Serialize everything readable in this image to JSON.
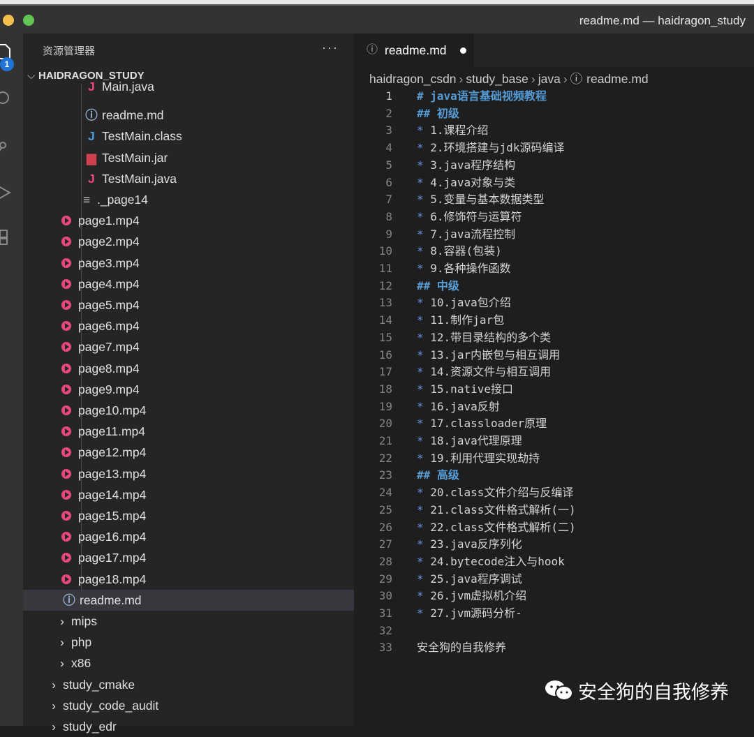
{
  "window": {
    "title": "readme.md — haidragon_study"
  },
  "activity": {
    "badge": "1"
  },
  "sidebar": {
    "header": "资源管理器",
    "more": "···",
    "root": "HAIDRAGON_STUDY",
    "items": [
      {
        "label": "Main.java",
        "icon": "java-icon",
        "glyph": "J",
        "color": "#e9487c"
      },
      {
        "label": "readme.md",
        "icon": "info-icon",
        "glyph": "ⓘ",
        "color": "#9ab6d6"
      },
      {
        "label": "TestMain.class",
        "icon": "java-class-icon",
        "glyph": "J",
        "color": "#4b9cdb"
      },
      {
        "label": "TestMain.jar",
        "icon": "jar-icon",
        "glyph": "▆",
        "color": "#d0414f"
      },
      {
        "label": "TestMain.java",
        "icon": "java-icon",
        "glyph": "J",
        "color": "#e9487c"
      },
      {
        "label": "._page14",
        "icon": "file-lines-icon",
        "glyph": "≡",
        "color": "#cccccc"
      },
      {
        "label": "page1.mp4"
      },
      {
        "label": "page2.mp4"
      },
      {
        "label": "page3.mp4"
      },
      {
        "label": "page4.mp4"
      },
      {
        "label": "page5.mp4"
      },
      {
        "label": "page6.mp4"
      },
      {
        "label": "page7.mp4"
      },
      {
        "label": "page8.mp4"
      },
      {
        "label": "page9.mp4"
      },
      {
        "label": "page10.mp4"
      },
      {
        "label": "page11.mp4"
      },
      {
        "label": "page12.mp4"
      },
      {
        "label": "page13.mp4"
      },
      {
        "label": "page14.mp4"
      },
      {
        "label": "page15.mp4"
      },
      {
        "label": "page16.mp4"
      },
      {
        "label": "page17.mp4"
      },
      {
        "label": "page18.mp4"
      },
      {
        "label": "readme.md",
        "icon": "info-icon",
        "glyph": "ⓘ",
        "color": "#9ab6d6",
        "selected": true
      },
      {
        "label": "mips",
        "chevron": "›"
      },
      {
        "label": "php",
        "chevron": "›"
      },
      {
        "label": "x86",
        "chevron": "›"
      },
      {
        "label": "study_cmake",
        "chevron": "›"
      },
      {
        "label": "study_code_audit",
        "chevron": "›"
      },
      {
        "label": "study_edr",
        "chevron": "›"
      }
    ]
  },
  "editor": {
    "tab": {
      "label": "readme.md"
    },
    "breadcrumb": [
      "haidragon_csdn",
      "study_base",
      "java",
      "readme.md"
    ],
    "lines": [
      {
        "n": "1",
        "kind": "h",
        "mark": "#",
        "text": "java语言基础视频教程"
      },
      {
        "n": "2",
        "kind": "h",
        "mark": "##",
        "text": "初级"
      },
      {
        "n": "3",
        "kind": "b",
        "mark": "*",
        "text": "1.课程介绍"
      },
      {
        "n": "4",
        "kind": "b",
        "mark": "*",
        "text": "2.环境搭建与jdk源码编译"
      },
      {
        "n": "5",
        "kind": "b",
        "mark": "*",
        "text": "3.java程序结构"
      },
      {
        "n": "6",
        "kind": "b",
        "mark": "*",
        "text": "4.java对象与类"
      },
      {
        "n": "7",
        "kind": "b",
        "mark": "*",
        "text": "5.变量与基本数据类型"
      },
      {
        "n": "8",
        "kind": "b",
        "mark": "*",
        "text": "6.修饰符与运算符"
      },
      {
        "n": "9",
        "kind": "b",
        "mark": "*",
        "text": "7.java流程控制"
      },
      {
        "n": "10",
        "kind": "b",
        "mark": "*",
        "text": "8.容器(包装)"
      },
      {
        "n": "11",
        "kind": "b",
        "mark": "*",
        "text": "9.各种操作函数"
      },
      {
        "n": "12",
        "kind": "h",
        "mark": "##",
        "text": "中级"
      },
      {
        "n": "13",
        "kind": "b",
        "mark": "*",
        "text": "10.java包介绍"
      },
      {
        "n": "14",
        "kind": "b",
        "mark": "*",
        "text": "11.制作jar包"
      },
      {
        "n": "15",
        "kind": "b",
        "mark": "*",
        "text": "12.带目录结构的多个类"
      },
      {
        "n": "16",
        "kind": "b",
        "mark": "*",
        "text": "13.jar内嵌包与相互调用"
      },
      {
        "n": "17",
        "kind": "b",
        "mark": "*",
        "text": "14.资源文件与相互调用"
      },
      {
        "n": "18",
        "kind": "b",
        "mark": "*",
        "text": "15.native接口"
      },
      {
        "n": "19",
        "kind": "b",
        "mark": "*",
        "text": "16.java反射"
      },
      {
        "n": "20",
        "kind": "b",
        "mark": "*",
        "text": "17.classloader原理"
      },
      {
        "n": "21",
        "kind": "b",
        "mark": "*",
        "text": "18.java代理原理"
      },
      {
        "n": "22",
        "kind": "b",
        "mark": "*",
        "text": "19.利用代理实现劫持"
      },
      {
        "n": "23",
        "kind": "h",
        "mark": "##",
        "text": "高级"
      },
      {
        "n": "24",
        "kind": "b",
        "mark": "*",
        "text": "20.class文件介绍与反编译"
      },
      {
        "n": "25",
        "kind": "b",
        "mark": "*",
        "text": "21.class文件格式解析(一)"
      },
      {
        "n": "26",
        "kind": "b",
        "mark": "*",
        "text": "22.class文件格式解析(二)"
      },
      {
        "n": "27",
        "kind": "b",
        "mark": "*",
        "text": "23.java反序列化"
      },
      {
        "n": "28",
        "kind": "b",
        "mark": "*",
        "text": "24.bytecode注入与hook"
      },
      {
        "n": "29",
        "kind": "b",
        "mark": "*",
        "text": "25.java程序调试"
      },
      {
        "n": "30",
        "kind": "b",
        "mark": "*",
        "text": "26.jvm虚拟机介绍"
      },
      {
        "n": "31",
        "kind": "b",
        "mark": "*",
        "text": "27.jvm源码分析-"
      },
      {
        "n": "32",
        "kind": "p",
        "mark": "",
        "text": ""
      },
      {
        "n": "33",
        "kind": "p",
        "mark": "",
        "text": "安全狗的自我修养"
      }
    ]
  },
  "watermark": {
    "text": "安全狗的自我修养"
  }
}
